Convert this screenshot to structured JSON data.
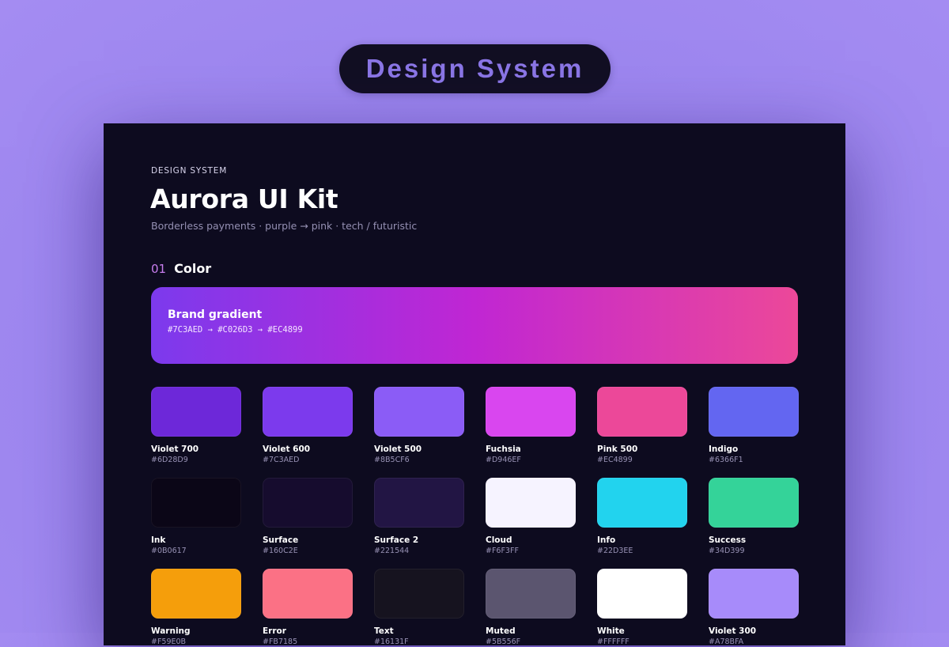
{
  "header": {
    "pill_label": "Design System"
  },
  "panel": {
    "eyebrow": "DESIGN SYSTEM",
    "title": "Aurora UI Kit",
    "subtitle": "Borderless payments  ·  purple → pink  ·  tech / futuristic",
    "section_number": "01",
    "section_title": "Color"
  },
  "gradient": {
    "title": "Brand gradient",
    "stops": "#7C3AED  →  #C026D3  →  #EC4899",
    "colors": [
      "#7C3AED",
      "#C026D3",
      "#EC4899"
    ]
  },
  "swatches": [
    {
      "name": "Violet 700",
      "hex": "#6D28D9"
    },
    {
      "name": "Violet 600",
      "hex": "#7C3AED"
    },
    {
      "name": "Violet 500",
      "hex": "#8B5CF6"
    },
    {
      "name": "Fuchsia",
      "hex": "#D946EF"
    },
    {
      "name": "Pink 500",
      "hex": "#EC4899"
    },
    {
      "name": "Indigo",
      "hex": "#6366F1"
    },
    {
      "name": "Ink",
      "hex": "#0B0617"
    },
    {
      "name": "Surface",
      "hex": "#160C2E"
    },
    {
      "name": "Surface 2",
      "hex": "#221544"
    },
    {
      "name": "Cloud",
      "hex": "#F6F3FF"
    },
    {
      "name": "Info",
      "hex": "#22D3EE"
    },
    {
      "name": "Success",
      "hex": "#34D399"
    },
    {
      "name": "Warning",
      "hex": "#F59E0B"
    },
    {
      "name": "Error",
      "hex": "#FB7185"
    },
    {
      "name": "Text",
      "hex": "#16131F"
    },
    {
      "name": "Muted",
      "hex": "#5B556F"
    },
    {
      "name": "White",
      "hex": "#FFFFFF"
    },
    {
      "name": "Violet 300",
      "hex": "#A78BFA"
    }
  ]
}
